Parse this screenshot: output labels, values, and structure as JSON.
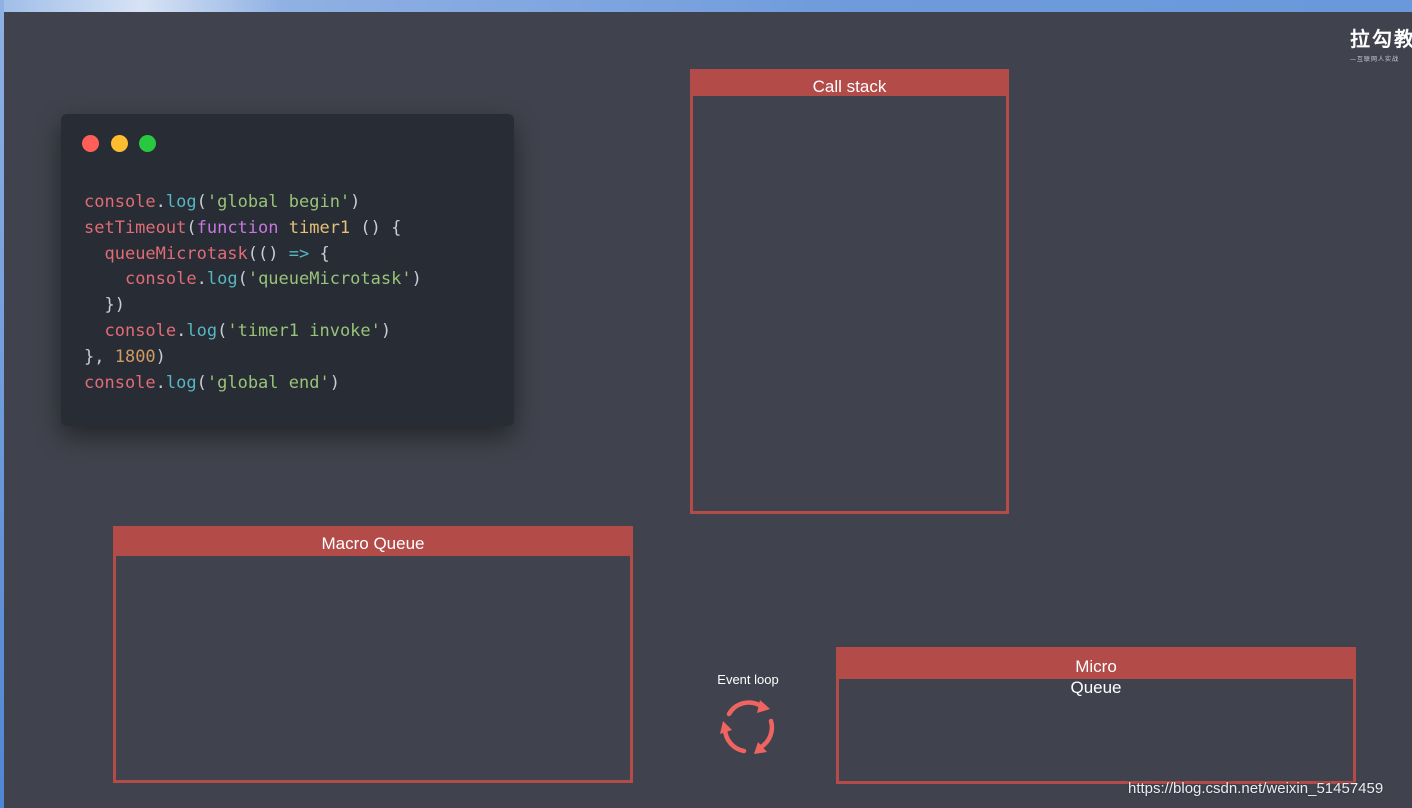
{
  "logo": {
    "title": "拉勾教",
    "subtitle": "—互联网人实战"
  },
  "code_window": {
    "lines": [
      [
        {
          "t": "console",
          "c": "c-id"
        },
        {
          "t": ".",
          "c": "c-p"
        },
        {
          "t": "log",
          "c": "c-fn"
        },
        {
          "t": "(",
          "c": "c-p"
        },
        {
          "t": "'global begin'",
          "c": "c-str"
        },
        {
          "t": ")",
          "c": "c-p"
        }
      ],
      [
        {
          "t": "setTimeout",
          "c": "c-id"
        },
        {
          "t": "(",
          "c": "c-p"
        },
        {
          "t": "function",
          "c": "c-kw"
        },
        {
          "t": " ",
          "c": "c-p"
        },
        {
          "t": "timer1",
          "c": "c-name"
        },
        {
          "t": " () {",
          "c": "c-p"
        }
      ],
      [
        {
          "t": "  ",
          "c": "c-p"
        },
        {
          "t": "queueMicrotask",
          "c": "c-id"
        },
        {
          "t": "(() ",
          "c": "c-p"
        },
        {
          "t": "=>",
          "c": "c-op"
        },
        {
          "t": " {",
          "c": "c-p"
        }
      ],
      [
        {
          "t": "    ",
          "c": "c-p"
        },
        {
          "t": "console",
          "c": "c-id"
        },
        {
          "t": ".",
          "c": "c-p"
        },
        {
          "t": "log",
          "c": "c-fn"
        },
        {
          "t": "(",
          "c": "c-p"
        },
        {
          "t": "'queueMicrotask'",
          "c": "c-str"
        },
        {
          "t": ")",
          "c": "c-p"
        }
      ],
      [
        {
          "t": "  })",
          "c": "c-p"
        }
      ],
      [
        {
          "t": "  ",
          "c": "c-p"
        },
        {
          "t": "console",
          "c": "c-id"
        },
        {
          "t": ".",
          "c": "c-p"
        },
        {
          "t": "log",
          "c": "c-fn"
        },
        {
          "t": "(",
          "c": "c-p"
        },
        {
          "t": "'timer1 invoke'",
          "c": "c-str"
        },
        {
          "t": ")",
          "c": "c-p"
        }
      ],
      [
        {
          "t": "}, ",
          "c": "c-p"
        },
        {
          "t": "1800",
          "c": "c-num"
        },
        {
          "t": ")",
          "c": "c-p"
        }
      ],
      [
        {
          "t": "console",
          "c": "c-id"
        },
        {
          "t": ".",
          "c": "c-p"
        },
        {
          "t": "log",
          "c": "c-fn"
        },
        {
          "t": "(",
          "c": "c-p"
        },
        {
          "t": "'global end'",
          "c": "c-str"
        },
        {
          "t": ")",
          "c": "c-p"
        }
      ]
    ]
  },
  "call_stack": {
    "title": "Call stack"
  },
  "macro_queue": {
    "title": "Macro Queue"
  },
  "micro_queue": {
    "title_line1": "Micro",
    "title_line2": "Queue"
  },
  "event_loop": {
    "label": "Event loop",
    "icon": "refresh-cycle-icon"
  },
  "watermark": "https://blog.csdn.net/weixin_51457459",
  "colors": {
    "panel_accent": "#b34b48",
    "stage_background": "#40434d",
    "code_background": "#282c35",
    "event_loop_icon": "#ef6461"
  }
}
